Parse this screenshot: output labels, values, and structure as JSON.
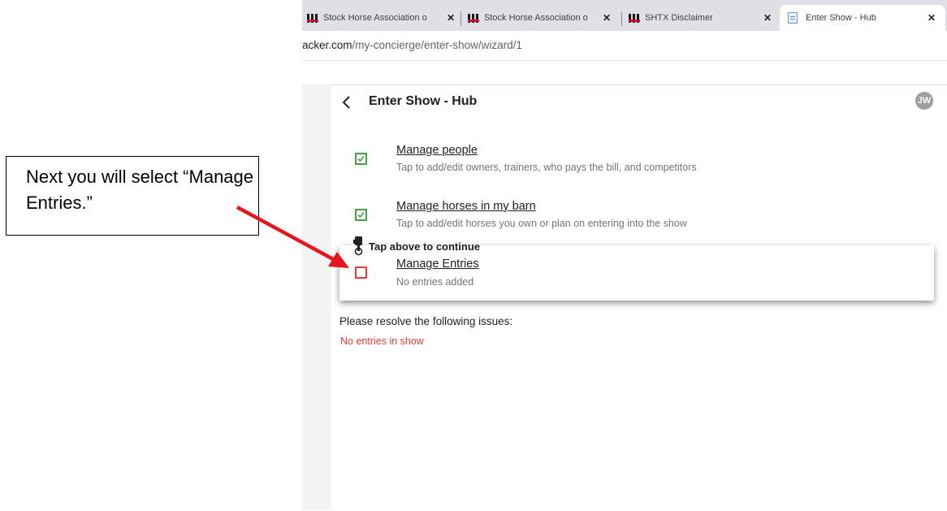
{
  "browser": {
    "tabs": [
      {
        "title": "Stock Horse Association o",
        "favicon": "shx-logo-icon",
        "active": false
      },
      {
        "title": "Stock Horse Association o",
        "favicon": "shx-logo-icon",
        "active": false
      },
      {
        "title": "SHTX Disclaimer",
        "favicon": "shx-logo-icon",
        "active": false
      },
      {
        "title": "Enter Show - Hub",
        "favicon": "document-icon",
        "active": true
      }
    ],
    "close_glyph": "✕",
    "url": {
      "host": "acker.com",
      "path": "/my-concierge/enter-show/wizard/1"
    }
  },
  "header": {
    "title": "Enter Show - Hub",
    "avatar_initials": "JW"
  },
  "tasks": [
    {
      "title": "Manage people",
      "subtitle": "Tap to add/edit owners, trainers, who pays the bill, and competitors",
      "checked": true
    },
    {
      "title": "Manage horses in my barn",
      "subtitle": "Tap to add/edit horses you own or plan on entering into the show",
      "checked": true
    },
    {
      "title": "Manage Entries",
      "subtitle": "No entries added",
      "checked": false
    }
  ],
  "hint": {
    "text": "Tap above to continue",
    "icon": "tap-hand-icon"
  },
  "issues": {
    "title": "Please resolve the following issues:",
    "items": [
      "No entries in show"
    ]
  },
  "callout": {
    "text": "Next you will select “Manage Entries.”"
  },
  "colors": {
    "checked": "#43a047",
    "unchecked": "#e53935",
    "issue": "#e53935",
    "arrow": "#e8141b"
  }
}
